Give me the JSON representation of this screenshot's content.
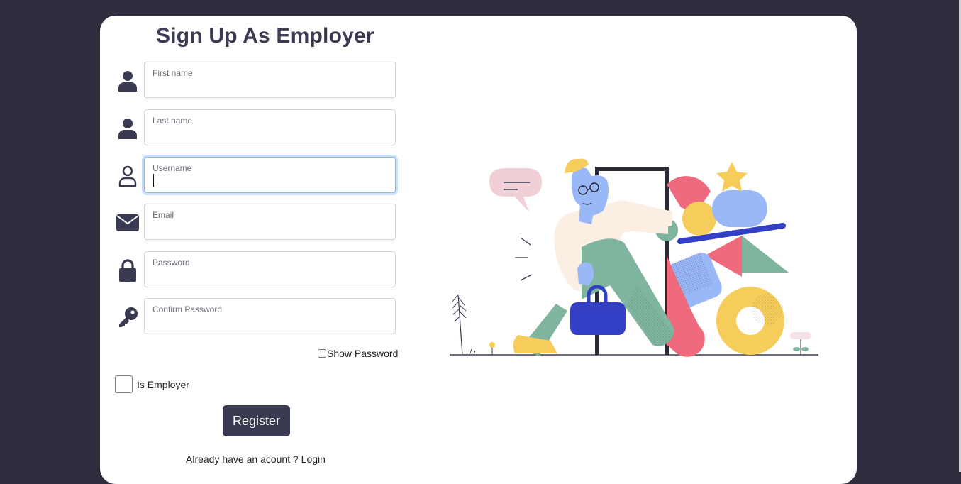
{
  "page": {
    "title": "Sign Up As Employer"
  },
  "fields": [
    {
      "label": "First name",
      "icon": "person-icon",
      "value": ""
    },
    {
      "label": "Last name",
      "icon": "person-icon",
      "value": ""
    },
    {
      "label": "Username",
      "icon": "person-outline-icon",
      "value": "",
      "focused": true
    },
    {
      "label": "Email",
      "icon": "envelope-icon",
      "value": ""
    },
    {
      "label": "Password",
      "icon": "lock-icon",
      "value": ""
    },
    {
      "label": "Confirm Password",
      "icon": "key-icon",
      "value": ""
    }
  ],
  "show_password": {
    "label": "Show Password",
    "checked": false
  },
  "is_employer": {
    "label": "Is Employer",
    "checked": false
  },
  "register": {
    "label": "Register"
  },
  "login_prompt": {
    "text": "Already have an acount ? ",
    "link": "Login"
  },
  "colors": {
    "background": "#2d2d3d",
    "card": "#ffffff",
    "primary": "#3a3b52",
    "focus_border": "#86b7fe"
  }
}
